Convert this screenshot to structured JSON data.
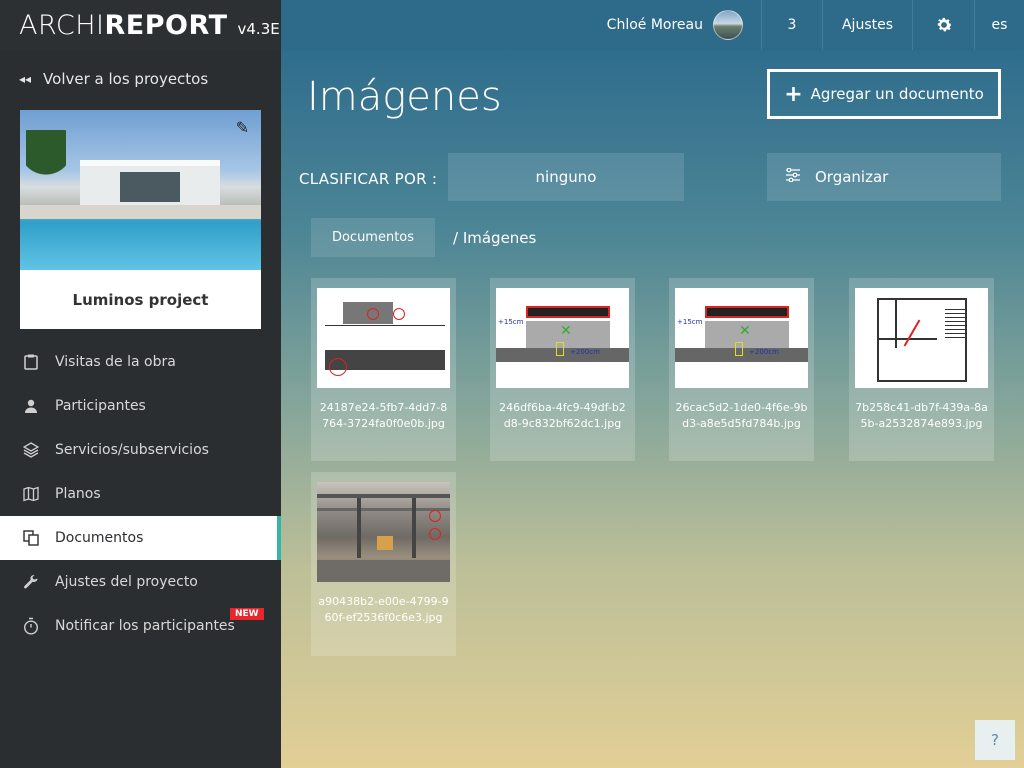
{
  "app": {
    "brand_light": "ARCHI",
    "brand_bold": "REPORT",
    "version": "v4.3E"
  },
  "header": {
    "user_name": "Chloé Moreau",
    "notif_count": "3",
    "settings_label": "Ajustes",
    "language": "es"
  },
  "sidebar": {
    "back_label": "Volver a los proyectos",
    "project_name": "Luminos project",
    "items": [
      {
        "label": "Visitas de la obra",
        "icon": "clipboard-icon"
      },
      {
        "label": "Participantes",
        "icon": "person-icon"
      },
      {
        "label": "Servicios/subservicios",
        "icon": "layers-icon"
      },
      {
        "label": "Planos",
        "icon": "map-icon"
      },
      {
        "label": "Documentos",
        "icon": "documents-icon"
      },
      {
        "label": "Ajustes del proyecto",
        "icon": "wrench-icon"
      },
      {
        "label": "Notificar los participantes",
        "icon": "stopwatch-icon"
      }
    ],
    "active_item": "Documentos",
    "new_badge": "NEW"
  },
  "main": {
    "title": "Imágenes",
    "add_button": "Agregar un documento",
    "sort_label": "CLASIFICAR POR :",
    "sort_value": "ninguno",
    "organize_button": "Organizar",
    "breadcrumb_root": "Documentos",
    "breadcrumb_current": "/ Imágenes",
    "files": [
      "24187e24-5fb7-4dd7-8764-3724fa0f0e0b.jpg",
      "246df6ba-4fc9-49df-b2d8-9c832bf62dc1.jpg",
      "26cac5d2-1de0-4f6e-9bd3-a8e5d5fd784b.jpg",
      "7b258c41-db7f-439a-8a5b-a2532874e893.jpg",
      "a90438b2-e00e-4799-960f-ef2536f0c6e3.jpg"
    ]
  },
  "help": {
    "label": "?"
  },
  "elev_labels": {
    "height": "+15cm",
    "width": "+200cm"
  }
}
